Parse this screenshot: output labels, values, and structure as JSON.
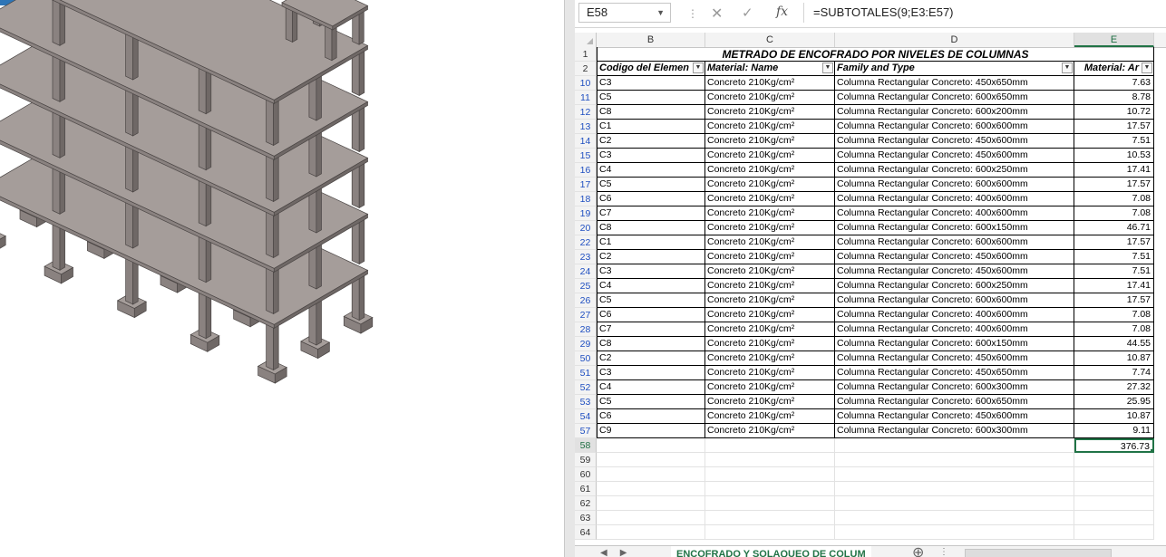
{
  "formula_bar": {
    "name_box": "E58",
    "fx_label": "fx",
    "formula": "=SUBTOTALES(9;E3:E57)"
  },
  "columns": [
    "B",
    "C",
    "D",
    "E"
  ],
  "sheet": {
    "title": "METRADO DE ENCOFRADO POR NIVELES DE COLUMNAS",
    "headers": [
      "Codigo del Elemen",
      "Material: Name",
      "Family and Type",
      "Material: Ar"
    ],
    "rows": [
      {
        "rn": "10",
        "code": "C3",
        "material": "Concreto 210Kg/cm²",
        "family": "Columna Rectangular Concreto: 450x650mm",
        "area": "7.63"
      },
      {
        "rn": "11",
        "code": "C5",
        "material": "Concreto 210Kg/cm²",
        "family": "Columna Rectangular Concreto: 600x650mm",
        "area": "8.78"
      },
      {
        "rn": "12",
        "code": "C8",
        "material": "Concreto 210Kg/cm²",
        "family": "Columna Rectangular Concreto: 600x200mm",
        "area": "10.72"
      },
      {
        "rn": "13",
        "code": "C1",
        "material": "Concreto 210Kg/cm²",
        "family": "Columna Rectangular Concreto: 600x600mm",
        "area": "17.57"
      },
      {
        "rn": "14",
        "code": "C2",
        "material": "Concreto 210Kg/cm²",
        "family": "Columna Rectangular Concreto: 450x600mm",
        "area": "7.51"
      },
      {
        "rn": "15",
        "code": "C3",
        "material": "Concreto 210Kg/cm²",
        "family": "Columna Rectangular Concreto: 450x600mm",
        "area": "10.53"
      },
      {
        "rn": "16",
        "code": "C4",
        "material": "Concreto 210Kg/cm²",
        "family": "Columna Rectangular Concreto: 600x250mm",
        "area": "17.41"
      },
      {
        "rn": "17",
        "code": "C5",
        "material": "Concreto 210Kg/cm²",
        "family": "Columna Rectangular Concreto: 600x600mm",
        "area": "17.57"
      },
      {
        "rn": "18",
        "code": "C6",
        "material": "Concreto 210Kg/cm²",
        "family": "Columna Rectangular Concreto: 400x600mm",
        "area": "7.08"
      },
      {
        "rn": "19",
        "code": "C7",
        "material": "Concreto 210Kg/cm²",
        "family": "Columna Rectangular Concreto: 400x600mm",
        "area": "7.08"
      },
      {
        "rn": "20",
        "code": "C8",
        "material": "Concreto 210Kg/cm²",
        "family": "Columna Rectangular Concreto: 600x150mm",
        "area": "46.71"
      },
      {
        "rn": "22",
        "code": "C1",
        "material": "Concreto 210Kg/cm²",
        "family": "Columna Rectangular Concreto: 600x600mm",
        "area": "17.57"
      },
      {
        "rn": "23",
        "code": "C2",
        "material": "Concreto 210Kg/cm²",
        "family": "Columna Rectangular Concreto: 450x600mm",
        "area": "7.51"
      },
      {
        "rn": "24",
        "code": "C3",
        "material": "Concreto 210Kg/cm²",
        "family": "Columna Rectangular Concreto: 450x600mm",
        "area": "7.51"
      },
      {
        "rn": "25",
        "code": "C4",
        "material": "Concreto 210Kg/cm²",
        "family": "Columna Rectangular Concreto: 600x250mm",
        "area": "17.41"
      },
      {
        "rn": "26",
        "code": "C5",
        "material": "Concreto 210Kg/cm²",
        "family": "Columna Rectangular Concreto: 600x600mm",
        "area": "17.57"
      },
      {
        "rn": "27",
        "code": "C6",
        "material": "Concreto 210Kg/cm²",
        "family": "Columna Rectangular Concreto: 400x600mm",
        "area": "7.08"
      },
      {
        "rn": "28",
        "code": "C7",
        "material": "Concreto 210Kg/cm²",
        "family": "Columna Rectangular Concreto: 400x600mm",
        "area": "7.08"
      },
      {
        "rn": "29",
        "code": "C8",
        "material": "Concreto 210Kg/cm²",
        "family": "Columna Rectangular Concreto: 600x150mm",
        "area": "44.55"
      },
      {
        "rn": "50",
        "code": "C2",
        "material": "Concreto 210Kg/cm²",
        "family": "Columna Rectangular Concreto: 450x600mm",
        "area": "10.87"
      },
      {
        "rn": "51",
        "code": "C3",
        "material": "Concreto 210Kg/cm²",
        "family": "Columna Rectangular Concreto: 450x650mm",
        "area": "7.74"
      },
      {
        "rn": "52",
        "code": "C4",
        "material": "Concreto 210Kg/cm²",
        "family": "Columna Rectangular Concreto: 600x300mm",
        "area": "27.32"
      },
      {
        "rn": "53",
        "code": "C5",
        "material": "Concreto 210Kg/cm²",
        "family": "Columna Rectangular Concreto: 600x650mm",
        "area": "25.95"
      },
      {
        "rn": "54",
        "code": "C6",
        "material": "Concreto 210Kg/cm²",
        "family": "Columna Rectangular Concreto: 450x600mm",
        "area": "10.87"
      },
      {
        "rn": "57",
        "code": "C9",
        "material": "Concreto 210Kg/cm²",
        "family": "Columna Rectangular Concreto: 600x300mm",
        "area": "9.11"
      }
    ],
    "total_row": {
      "rn": "58",
      "area": "376.73"
    },
    "empty_rows": [
      "59",
      "60",
      "61",
      "62",
      "63",
      "64"
    ]
  },
  "tabs": {
    "active": "ENCOFRADO Y SOLAQUEO DE COLUM"
  },
  "colors": {
    "accent": "#217346",
    "filtered_row_number": "#1f4fc1",
    "concrete": "#8a8280"
  },
  "icons": [
    "cancel-icon",
    "enter-icon",
    "function-icon",
    "filter-icon",
    "sheet-nav-icons",
    "add-sheet-icon"
  ]
}
